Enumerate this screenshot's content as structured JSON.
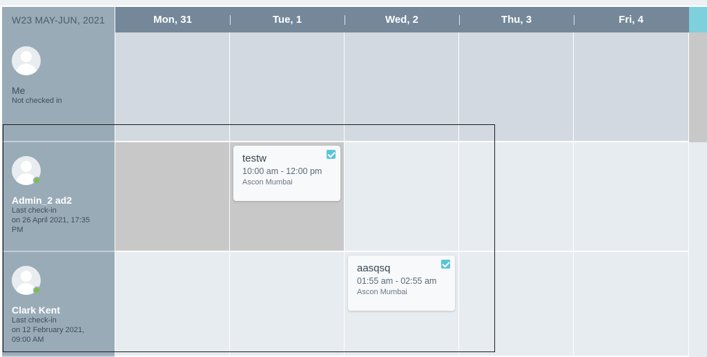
{
  "week": {
    "label": "W23 MAY-JUN, 2021"
  },
  "days": [
    "Mon, 31",
    "Tue, 1",
    "Wed, 2",
    "Thu, 3",
    "Fri, 4"
  ],
  "people": [
    {
      "name": "Me",
      "status_line1": "Not checked in",
      "status_line2": "",
      "status_line3": "",
      "online": false
    },
    {
      "name": "Admin_2 ad2",
      "status_line1": "Last check-in",
      "status_line2": "on 26 April 2021, 17:35",
      "status_line3": "PM",
      "online": true
    },
    {
      "name": "Clark Kent",
      "status_line1": "Last check-in",
      "status_line2": "on 12 February 2021,",
      "status_line3": "09:00 AM",
      "online": true
    }
  ],
  "events": [
    {
      "title": "testw",
      "time": "10:00 am - 12:00 pm",
      "location": "Ascon Mumbai",
      "checked": true
    },
    {
      "title": "aasqsq",
      "time": "01:55 am - 02:55 am",
      "location": "Ascon Mumbai",
      "checked": true
    }
  ],
  "colors": {
    "header": "#74889a",
    "sidebar": "#9aabb8",
    "accent": "#7ed0dc",
    "online": "#7ac142",
    "check": "#5bc4d8"
  }
}
